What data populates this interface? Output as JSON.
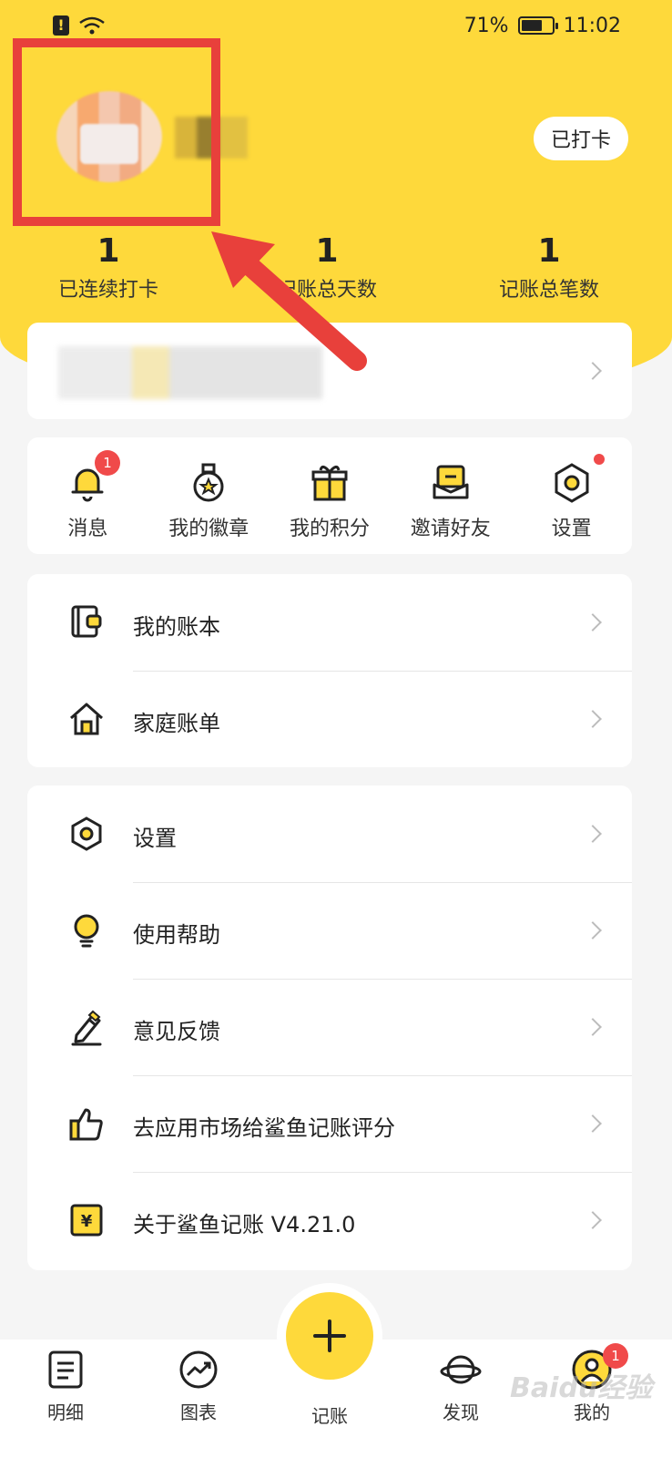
{
  "status_bar": {
    "battery": "71%",
    "time": "11:02",
    "battery_level": 0.71
  },
  "profile": {
    "checkin_button": "已打卡"
  },
  "stats": [
    {
      "value": "1",
      "label": "已连续打卡"
    },
    {
      "value": "1",
      "label": "记账总天数"
    },
    {
      "value": "1",
      "label": "记账总笔数"
    }
  ],
  "shortcuts": [
    {
      "label": "消息",
      "icon": "bell-icon",
      "badge": "1"
    },
    {
      "label": "我的徽章",
      "icon": "medal-icon"
    },
    {
      "label": "我的积分",
      "icon": "gift-icon"
    },
    {
      "label": "邀请好友",
      "icon": "envelope-icon"
    },
    {
      "label": "设置",
      "icon": "hex-nut-icon",
      "dot": true
    }
  ],
  "books": [
    {
      "label": "我的账本",
      "icon": "wallet-book-icon"
    },
    {
      "label": "家庭账单",
      "icon": "house-icon"
    }
  ],
  "settings": [
    {
      "label": "设置",
      "icon": "hex-nut-icon"
    },
    {
      "label": "使用帮助",
      "icon": "lightbulb-icon"
    },
    {
      "label": "意见反馈",
      "icon": "pencil-icon"
    },
    {
      "label": "去应用市场给鲨鱼记账评分",
      "icon": "thumbs-up-icon"
    },
    {
      "label": "关于鲨鱼记账 V4.21.0",
      "icon": "yen-card-icon"
    }
  ],
  "tabbar": [
    {
      "label": "明细",
      "icon": "list-doc-icon"
    },
    {
      "label": "图表",
      "icon": "trend-chart-icon"
    },
    {
      "label": "记账",
      "icon": "plus-icon"
    },
    {
      "label": "发现",
      "icon": "planet-icon"
    },
    {
      "label": "我的",
      "icon": "user-icon",
      "badge": "1"
    }
  ],
  "watermark": "Baidu经验",
  "colors": {
    "brand_yellow": "#fed93b",
    "highlight_red": "#e8403b",
    "badge_red": "#f04a4a"
  }
}
